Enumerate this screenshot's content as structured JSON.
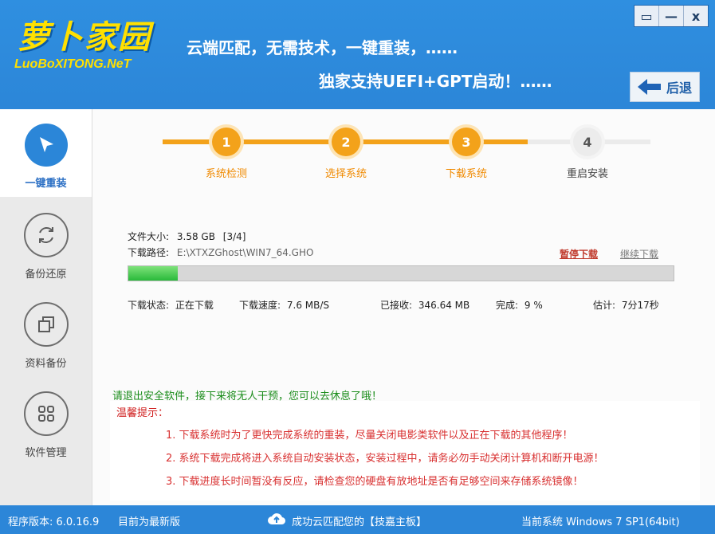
{
  "header": {
    "logo_main": "萝卜家园",
    "logo_sub": "LuoBoXITONG.NeT",
    "slogan1": "云端匹配，无需技术，一键重装，……",
    "slogan2": "独家支持UEFI+GPT启动！……",
    "back_label": "后退"
  },
  "window_controls": {
    "menu": "▭",
    "minimize": "—",
    "close": "x"
  },
  "sidebar": {
    "items": [
      {
        "label": "一键重装",
        "icon": "cursor-icon",
        "active": true
      },
      {
        "label": "备份还原",
        "icon": "refresh-icon",
        "active": false
      },
      {
        "label": "资料备份",
        "icon": "copy-icon",
        "active": false
      },
      {
        "label": "软件管理",
        "icon": "apps-grid-icon",
        "active": false
      }
    ]
  },
  "steps": [
    {
      "num": "1",
      "label": "系统检测",
      "done": true
    },
    {
      "num": "2",
      "label": "选择系统",
      "done": true
    },
    {
      "num": "3",
      "label": "下载系统",
      "done": true
    },
    {
      "num": "4",
      "label": "重启安装",
      "done": false
    }
  ],
  "download": {
    "size_label": "文件大小:",
    "size_value": "3.58 GB",
    "size_index": "[3/4]",
    "path_label": "下载路径:",
    "path_value": "E:\\XTXZGhost\\WIN7_64.GHO",
    "pause_label": "暂停下载",
    "resume_label": "继续下载",
    "progress": 0.09,
    "status_label": "下载状态:",
    "status_value": "正在下载",
    "speed_label": "下载速度:",
    "speed_value": "7.6 MB/S",
    "received_label": "已接收:",
    "received_value": "346.64 MB",
    "done_label": "完成:",
    "done_value": "9 %",
    "eta_label": "估计:",
    "eta_value": "7分17秒"
  },
  "notice": "请退出安全软件，接下来将无人干预，您可以去休息了哦！",
  "tips": {
    "title": "温馨提示：",
    "items": [
      "1. 下载系统时为了更快完成系统的重装，尽量关闭电影类软件以及正在下载的其他程序！",
      "2. 系统下载完成将进入系统自动安装状态，安装过程中，请务必勿手动关闭计算机和断开电源！",
      "3. 下载进度长时间暂没有反应，请检查您的硬盘有放地址是否有足够空间来存储系统镜像！"
    ]
  },
  "footer": {
    "version": "程序版本: 6.0.16.9",
    "update": "目前为最新版",
    "cloud": "成功云匹配您的【技嘉主板】",
    "os": "当前系统 Windows 7 SP1(64bit)"
  },
  "colors": {
    "brand_blue": "#2c86d8",
    "logo_yellow": "#ffe000",
    "step_orange": "#f3a21a",
    "tip_red": "#d83030",
    "notice_green": "#1a8c1a"
  }
}
